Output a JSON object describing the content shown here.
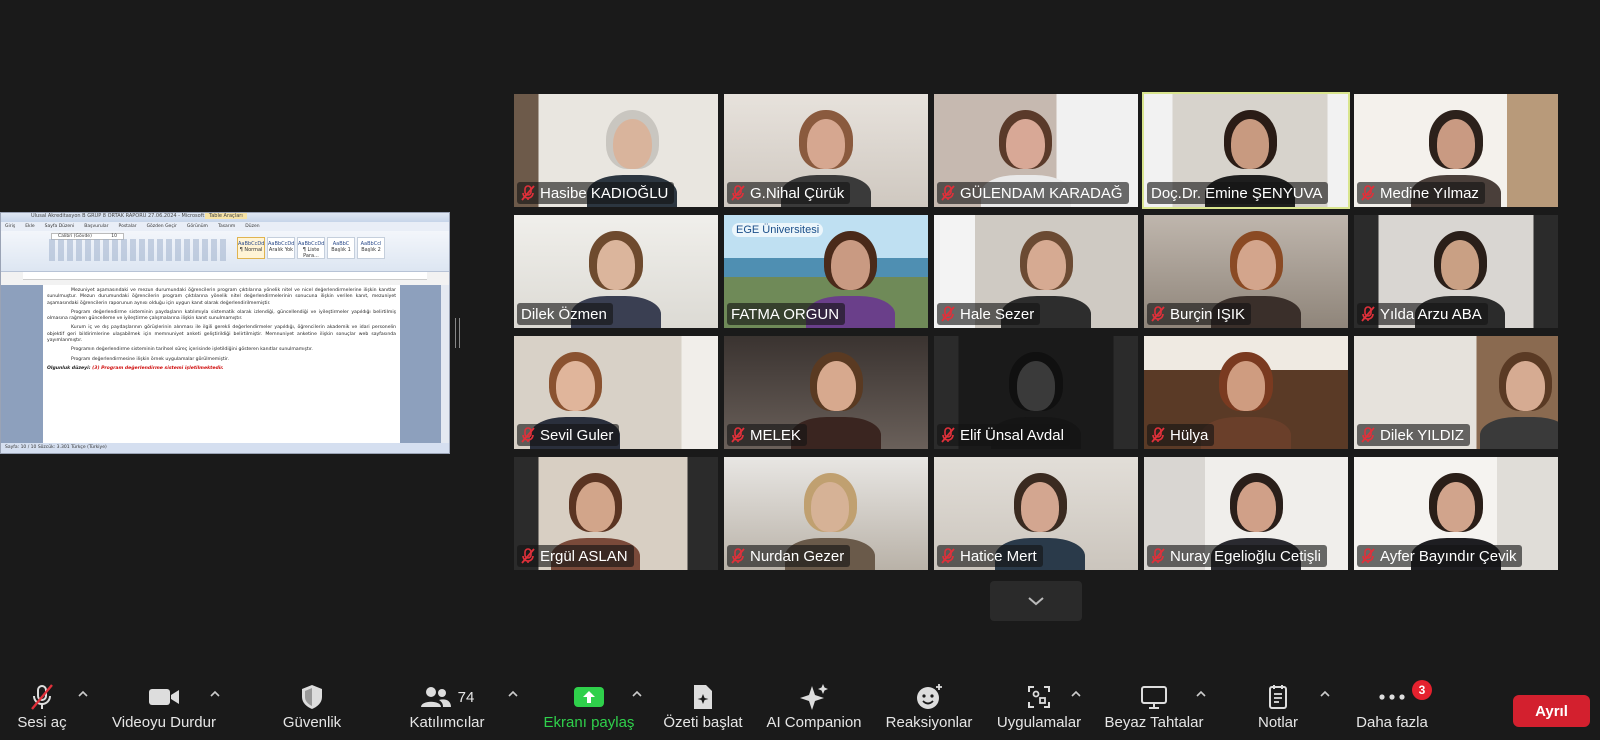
{
  "shared_screen": {
    "window_title": "Ulusal Akreditasyon B GRUP 8 ORTAK RAPORU 27.06.2024 - Microsoft Word",
    "context_tab": "Table Araçları",
    "tabs": [
      "Giriş",
      "Ekle",
      "Sayfa Düzeni",
      "Başvurular",
      "Postalar",
      "Gözden Geçir",
      "Görünüm",
      "Tasarım",
      "Düzen"
    ],
    "font_name": "Calibri (Gövde)",
    "font_size": "10",
    "styles": [
      "AaBbCcDd",
      "AaBbCcDd",
      "AaBbCcDd",
      "AaBbC",
      "AaBbCcl"
    ],
    "style_names": [
      "¶ Normal",
      "Aralık Yok",
      "¶ Liste Para...",
      "Başlık 1",
      "Başlık 2"
    ],
    "paragraphs": [
      "Mezuniyet aşamasındaki ve mezun durumundaki öğrencilerin program çıktılarına yönelik nitel ve nicel değerlendirmelerine ilişkin kanıtlar sunulmuştur. Mezun durumundaki öğrencilerin program çıktılarına yönelik nitel değerlendirmelerinin sonucuna ilişkin verilen kanıt, mezuniyet aşamasındaki öğrencilerin raporunun aynısı olduğu için uygun kanıt olarak değerlendirilmemiştir.",
      "Program değerlendirme sisteminin paydaşların katılımıyla sistematik olarak izlendiği, güncellendiği ve iyileştirmeler yapıldığı belirtilmiş olmasına rağmen güncelleme ve iyileştirme çalışmalarına ilişkin kanıt sunulmamıştır.",
      "Kurum iç ve dış paydaşlarının görüşlerinin alınması ile ilgili gerekli değerlendirmeler yapıldığı, öğrencilerin akademik ve idari personelin objektif geri bildirimlerine ulaşabilmek için memnuniyet anketi geliştirildiği belirtilmiştir. Memnuniyet anketine ilişkin sonuçlar web sayfasında yayımlanmıştır.",
      "Programın değerlendirme sisteminin tarihsel süreç içerisinde işletildiğini gösteren kanıtlar sunulmamıştır.",
      "Program değerlendirmesine ilişkin örnek uygulamalar görülmemiştir."
    ],
    "criterion_label": "Olgunluk düzeyi:",
    "criterion_value": "(3) Program değerlendirme sistemi işletilmektedir.",
    "status_text": "Sayfa: 10 / 10   Sözcük: 3.301   Türkçe (Türkiye)"
  },
  "participants": [
    {
      "name": "Hasibe KADIOĞLU",
      "muted": true
    },
    {
      "name": "G.Nihal Çürük",
      "muted": true
    },
    {
      "name": "GÜLENDAM KARADAĞ",
      "muted": true
    },
    {
      "name": "Doç.Dr. Emine ŞENYUVA",
      "muted": false,
      "active_speaker": true
    },
    {
      "name": "Medine Yılmaz",
      "muted": true
    },
    {
      "name": "Dilek Özmen",
      "muted": false
    },
    {
      "name": "FATMA ORGUN",
      "muted": false,
      "virtual_background_text": "EGE Üniversitesi"
    },
    {
      "name": "Hale Sezer",
      "muted": true
    },
    {
      "name": "Burçin IŞIK",
      "muted": true
    },
    {
      "name": "Yılda Arzu ABA",
      "muted": true
    },
    {
      "name": "Sevil Guler",
      "muted": true
    },
    {
      "name": "MELEK",
      "muted": true
    },
    {
      "name": "Elif Ünsal Avdal",
      "muted": true
    },
    {
      "name": "Hülya",
      "muted": true
    },
    {
      "name": "Dilek YILDIZ",
      "muted": true
    },
    {
      "name": "Ergül ASLAN",
      "muted": true
    },
    {
      "name": "Nurdan Gezer",
      "muted": true
    },
    {
      "name": "Hatice Mert",
      "muted": true
    },
    {
      "name": "Nuray Egelioğlu Cetişli",
      "muted": true
    },
    {
      "name": "Ayfer Bayındır Çevik",
      "muted": true
    }
  ],
  "toolbar": {
    "audio": "Sesi aç",
    "video": "Videoyu Durdur",
    "security": "Güvenlik",
    "participants": "Katılımcılar",
    "participant_count": "74",
    "share": "Ekranı paylaş",
    "summary": "Özeti başlat",
    "ai": "AI Companion",
    "reactions": "Reaksiyonlar",
    "apps": "Uygulamalar",
    "whiteboards": "Beyaz Tahtalar",
    "notes": "Notlar",
    "more": "Daha fazla",
    "more_badge": "3",
    "leave": "Ayrıl"
  },
  "colors": {
    "background": "#1a1a1a",
    "active_speaker_border": "#d9e58e",
    "muted_icon": "#e0303a",
    "share_green": "#2fd04b",
    "leave_red": "#d3202e"
  }
}
